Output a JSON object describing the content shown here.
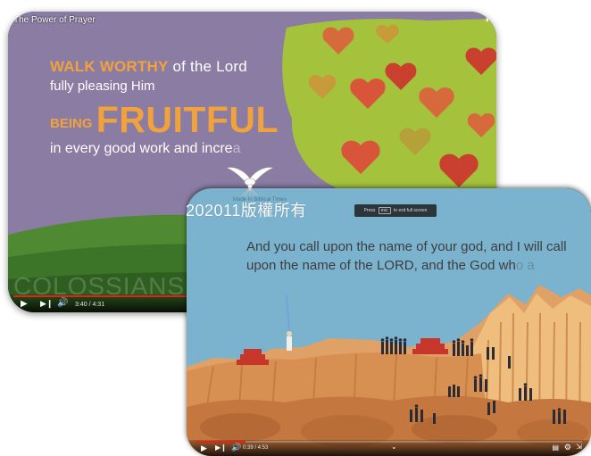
{
  "video_back": {
    "title": "The Power of Prayer",
    "verse": {
      "line1_em": "WALK WORTHY",
      "line1_rest": " of the Lord",
      "line2": "fully pleasing Him",
      "line3_small": "BEING ",
      "line3_big": "FRUITFUL",
      "line4": "in every good work and incre",
      "line4_fade": "a"
    },
    "book": "COLOSSIANS 1",
    "time": "3:40 / 4:31",
    "progress": 0.81
  },
  "video_front": {
    "chapter_text": "Made In Biblical Times",
    "toast": {
      "pre": "Press",
      "key": "esc",
      "post": "to exit full screen"
    },
    "subtitle_line1": "And you call upon the name of your god, and I will call",
    "subtitle_line2": "upon the name of the LORD, and the God wh",
    "subtitle_fade": "o a",
    "time": "0:39 / 4:53",
    "progress": 0.13
  },
  "watermark": "202011版權所有",
  "colors": {
    "accent": "#f2a23a",
    "progress": "#e62117",
    "purple": "#8b7ca3",
    "sky": "#7bb3cf"
  }
}
